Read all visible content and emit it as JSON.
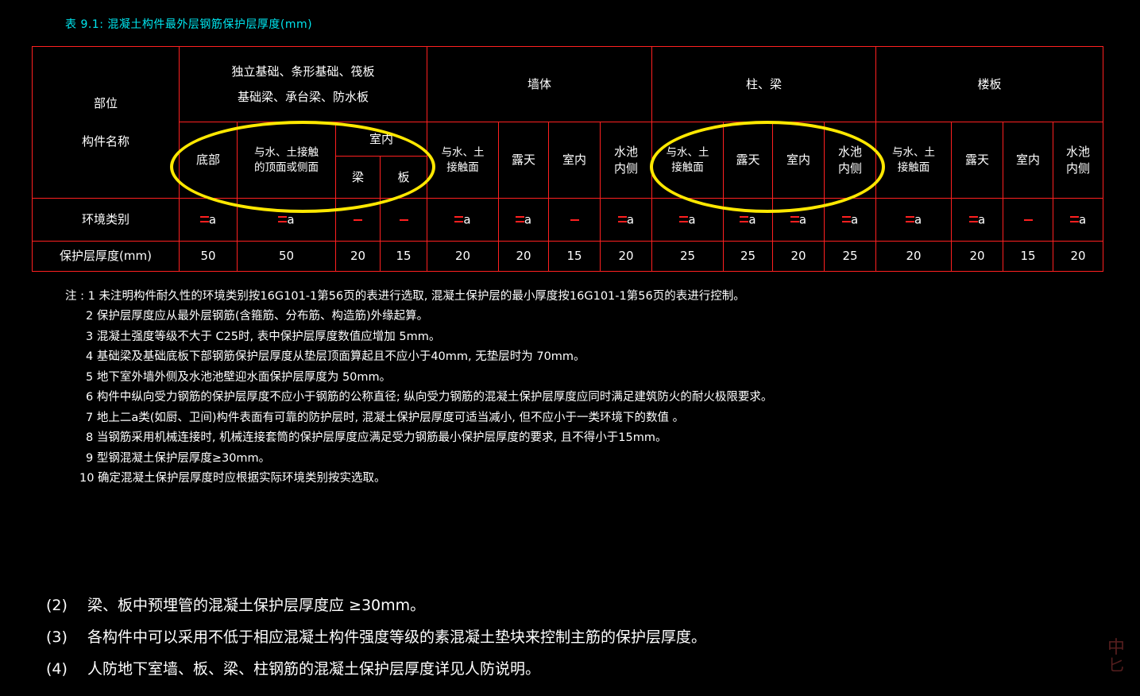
{
  "title": "表 9.1: 混凝土构件最外层钢筋保护层厚度(mm)",
  "table": {
    "corner_line1": "部位",
    "corner_line2": "构件名称",
    "row_labels": {
      "env": "环境类别",
      "thickness": "保护层厚度(mm)"
    },
    "groups": [
      {
        "label_line1": "独立基础、条形基础、筏板",
        "label_line2": "基础梁、承台梁、防水板",
        "span": 4
      },
      {
        "label_line1": "墙体",
        "label_line2": "",
        "span": 4
      },
      {
        "label_line1": "柱、梁",
        "label_line2": "",
        "span": 4
      },
      {
        "label_line1": "楼板",
        "label_line2": "",
        "span": 4
      }
    ],
    "columns": [
      {
        "line1": "底部",
        "line2": "",
        "env": "二a",
        "thickness": "50"
      },
      {
        "line1": "与水、土接触",
        "line2": "的顶面或侧面",
        "env": "二a",
        "thickness": "50"
      },
      {
        "line1": "室内",
        "line2": "梁",
        "env": "一",
        "thickness": "20"
      },
      {
        "line1": "室内",
        "line2": "板",
        "env": "一",
        "thickness": "15"
      },
      {
        "line1": "与水、土",
        "line2": "接触面",
        "env": "二a",
        "thickness": "20"
      },
      {
        "line1": "露天",
        "line2": "",
        "env": "二a",
        "thickness": "20"
      },
      {
        "line1": "室内",
        "line2": "",
        "env": "一",
        "thickness": "15"
      },
      {
        "line1": "水池",
        "line2": "内侧",
        "env": "二a",
        "thickness": "20"
      },
      {
        "line1": "与水、土",
        "line2": "接触面",
        "env": "二a",
        "thickness": "25"
      },
      {
        "line1": "露天",
        "line2": "",
        "env": "二a",
        "thickness": "25"
      },
      {
        "line1": "室内",
        "line2": "",
        "env": "二a",
        "thickness": "20"
      },
      {
        "line1": "水池",
        "line2": "内侧",
        "env": "二a",
        "thickness": "25"
      },
      {
        "line1": "与水、土",
        "line2": "接触面",
        "env": "二a",
        "thickness": "20"
      },
      {
        "line1": "露天",
        "line2": "",
        "env": "二a",
        "thickness": "20"
      },
      {
        "line1": "室内",
        "line2": "",
        "env": "一",
        "thickness": "15"
      },
      {
        "line1": "水池",
        "line2": "内侧",
        "env": "二a",
        "thickness": "20"
      }
    ],
    "indoor_merged_label": "室内",
    "indoor_sub": [
      "梁",
      "板"
    ]
  },
  "notes": [
    "注 : 1  未注明构件耐久性的环境类别按16G101-1第56页的表进行选取, 混凝土保护层的最小厚度按16G101-1第56页的表进行控制。",
    "2  保护层厚度应从最外层钢筋(含箍筋、分布筋、构造筋)外缘起算。",
    "3  混凝土强度等级不大于 C25时, 表中保护层厚度数值应增加 5mm。",
    "4  基础梁及基础底板下部钢筋保护层厚度从垫层顶面算起且不应小于40mm, 无垫层时为 70mm。",
    "5  地下室外墙外侧及水池池壁迎水面保护层厚度为 50mm。",
    "6  构件中纵向受力钢筋的保护层厚度不应小于钢筋的公称直径; 纵向受力钢筋的混凝土保护层厚度应同时满足建筑防火的耐火极限要求。",
    "7  地上二a类(如厨、卫间)构件表面有可靠的防护层时, 混凝土保护层厚度可适当减小, 但不应小于一类环境下的数值 。",
    "8  当钢筋采用机械连接时, 机械连接套筒的保护层厚度应满足受力钢筋最小保护层厚度的要求, 且不得小于15mm。",
    "9  型钢混凝土保护层厚度≥30mm。",
    "10  确定混凝土保护层厚度时应根据实际环境类别按实选取。"
  ],
  "bullets": [
    {
      "num": "(2)",
      "text": "梁、板中预埋管的混凝土保护层厚度应 ≥30mm。"
    },
    {
      "num": "(3)",
      "text": "各构件中可以采用不低于相应混凝土构件强度等级的素混凝土垫块来控制主筋的保护层厚度。"
    },
    {
      "num": "(4)",
      "text": "人防地下室墙、板、梁、柱钢筋的混凝土保护层厚度详见人防说明。"
    }
  ],
  "watermark": {
    "line1": "中",
    "line2": "匕"
  },
  "colors": {
    "background": "#000000",
    "title": "#00e5ee",
    "grid": "#ff2020",
    "values": "#ff2020",
    "header_text": "#ffffff",
    "highlight_ellipse": "#ffe800"
  }
}
